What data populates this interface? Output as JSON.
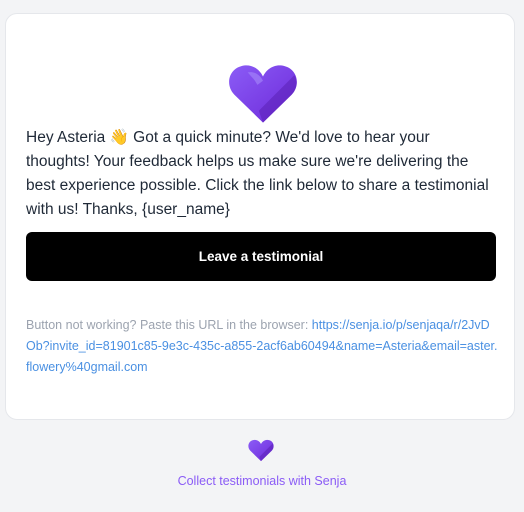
{
  "message": {
    "text": "Hey Asteria 👋 Got a quick minute? We'd love to hear your thoughts! Your feedback helps us make sure we're delivering the best experience possible. Click the link below to share a testimonial with us! Thanks, {user_name}"
  },
  "cta": {
    "label": "Leave a testimonial"
  },
  "fallback": {
    "prefix": "Button not working? Paste this URL in the browser: ",
    "url": "https://senja.io/p/senjaqa/r/2JvDOb?invite_id=81901c85-9e3c-435c-a855-2acf6ab60494&name=Asteria&email=aster.flowery%40gmail.com"
  },
  "footer": {
    "link_label": "Collect testimonials with Senja"
  },
  "colors": {
    "brand": "#7c3aed",
    "link": "#4a90e2",
    "button": "#000000"
  },
  "icons": {
    "logo": "heart-icon"
  }
}
